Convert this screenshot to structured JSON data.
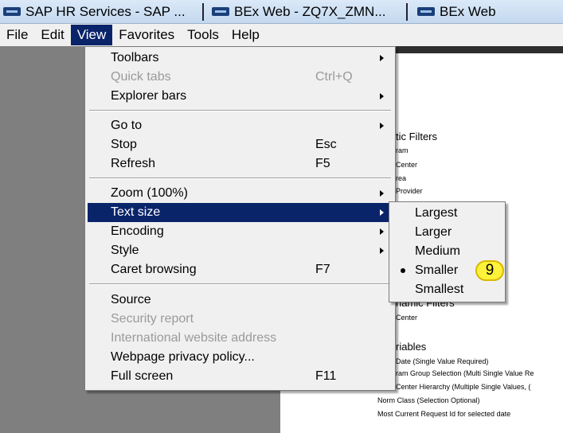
{
  "tabs": [
    {
      "label": "SAP HR Services - SAP ...",
      "icon": "sap-page-icon"
    },
    {
      "label": "BEx Web - ZQ7X_ZMN...",
      "icon": "sap-page-icon"
    },
    {
      "label": "BEx Web",
      "icon": "sap-page-icon"
    }
  ],
  "menubar": [
    "File",
    "Edit",
    "View",
    "Favorites",
    "Tools",
    "Help"
  ],
  "view_menu": {
    "toolbars": "Toolbars",
    "quick_tabs": "Quick tabs",
    "quick_tabs_shortcut": "Ctrl+Q",
    "explorer_bars": "Explorer bars",
    "go_to": "Go to",
    "stop": "Stop",
    "stop_shortcut": "Esc",
    "refresh": "Refresh",
    "refresh_shortcut": "F5",
    "zoom": "Zoom (100%)",
    "text_size": "Text size",
    "encoding": "Encoding",
    "style": "Style",
    "caret_browsing": "Caret browsing",
    "caret_browsing_shortcut": "F7",
    "source": "Source",
    "security_report": "Security report",
    "international_address": "International website address",
    "privacy_policy": "Webpage privacy policy...",
    "full_screen": "Full screen",
    "full_screen_shortcut": "F11"
  },
  "text_size_menu": {
    "items": [
      "Largest",
      "Larger",
      "Medium",
      "Smaller",
      "Smallest"
    ],
    "selected": "Smaller"
  },
  "step_badge": "9",
  "page": {
    "static_filters_heading": "tic Filters",
    "static_filter_items": [
      "ram",
      "Center",
      "rea",
      "Provider"
    ],
    "dynamic_filters_heading": "namic Filters",
    "dynamic_filter_items": [
      "Center"
    ],
    "variables_heading": "riables",
    "variable_items": [
      "Date (Single Value Required)",
      "ram Group Selection (Multi Single Value Re",
      "Center Hierarchy (Multiple Single Values, (",
      "Norm Class (Selection Optional)",
      "Most Current Request Id for selected date"
    ]
  },
  "colors": {
    "menu_highlight": "#0a246a",
    "left_panel": "#7f7f7f",
    "badge": "#fff23a"
  }
}
